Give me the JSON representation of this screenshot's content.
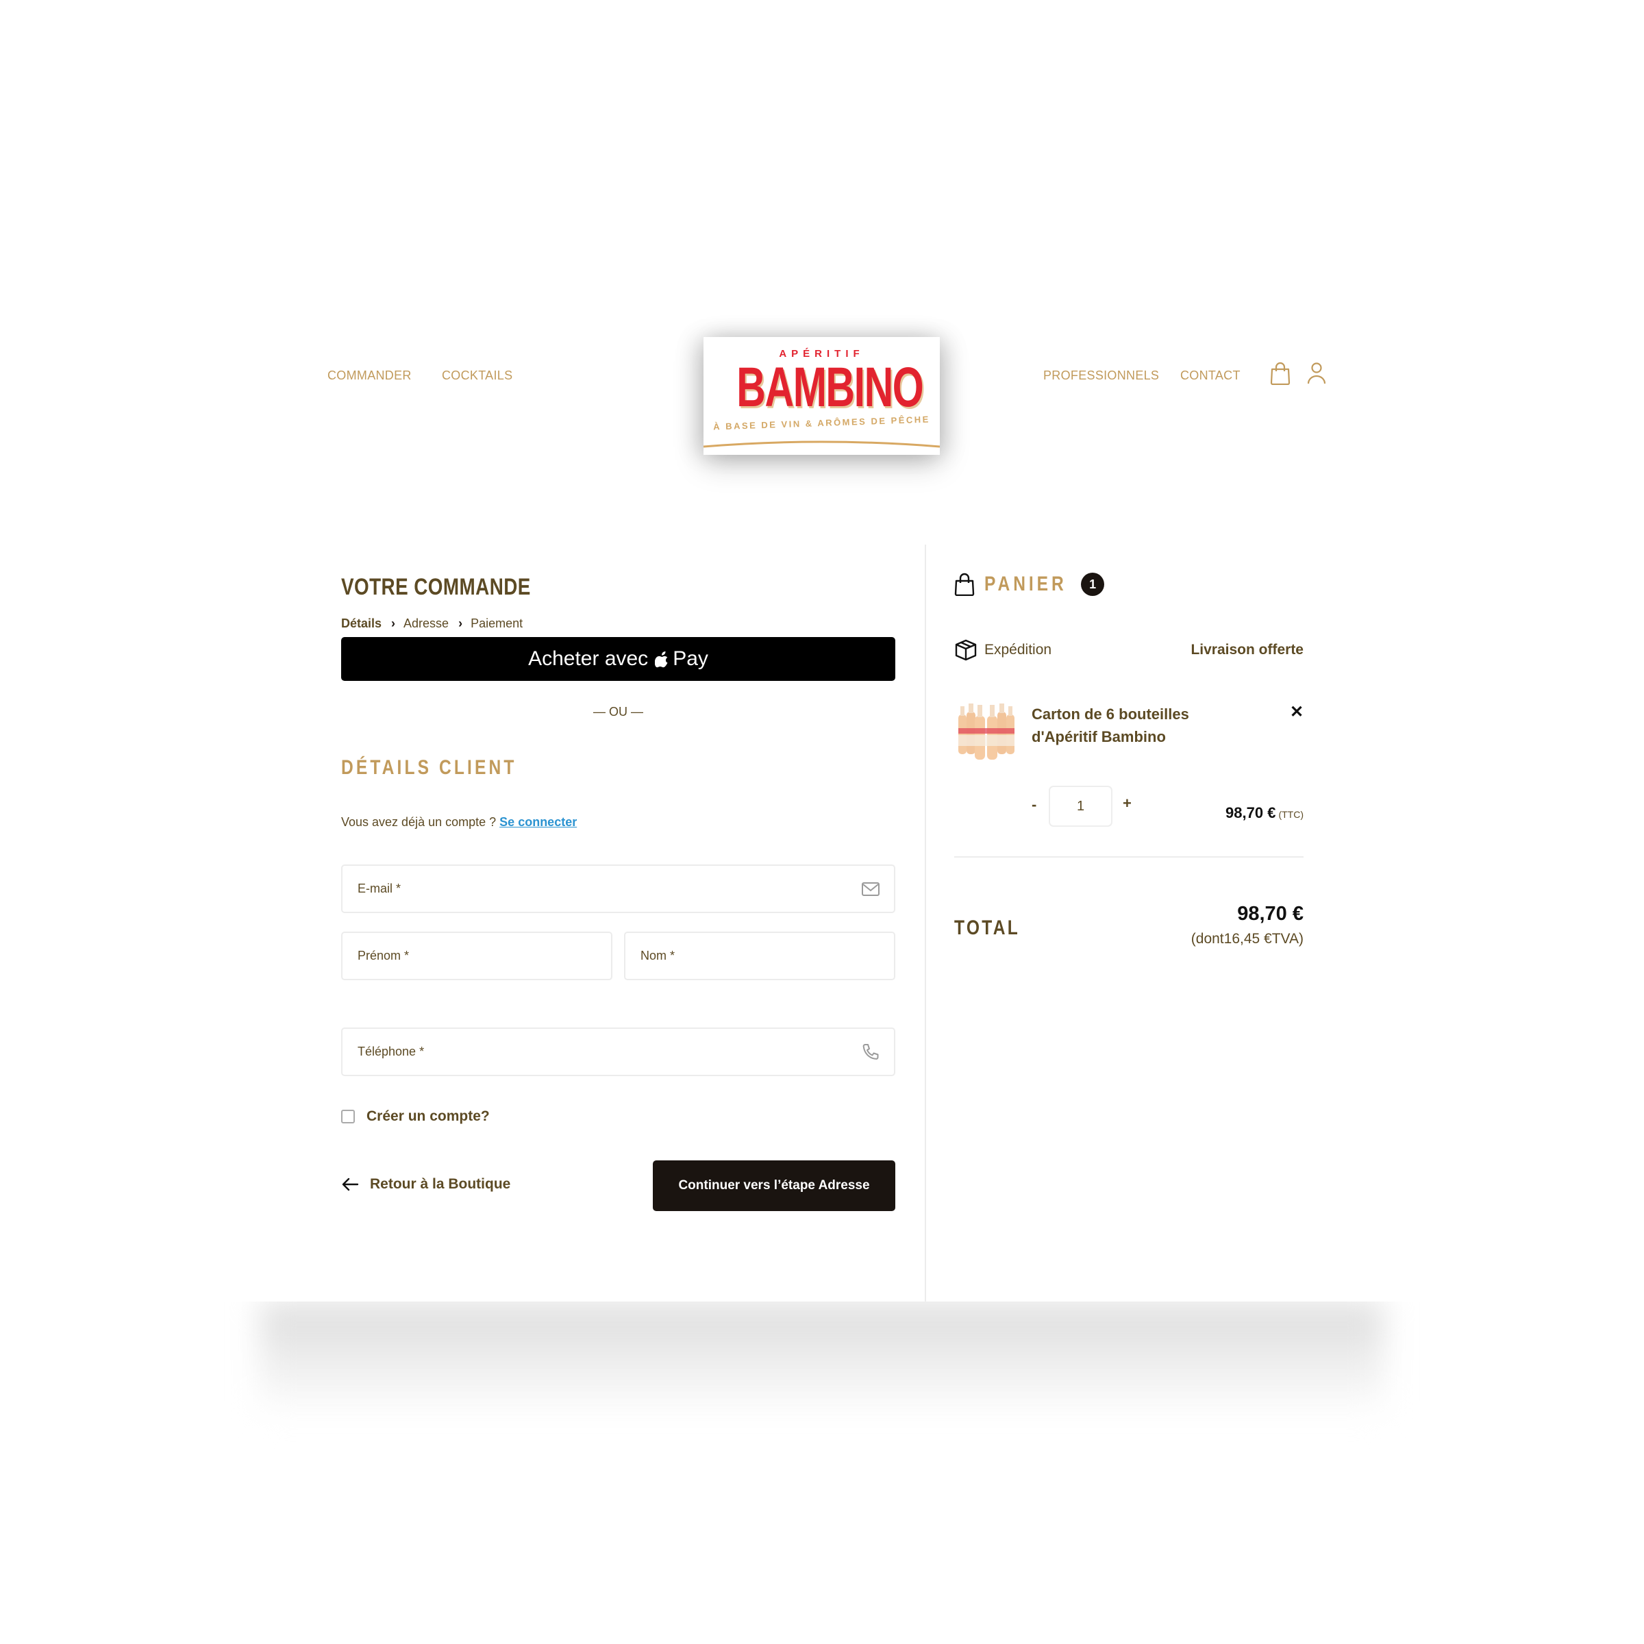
{
  "header": {
    "nav_left": [
      "COMMANDER",
      "COCKTAILS"
    ],
    "nav_right": [
      "PROFESSIONNELS",
      "CONTACT"
    ],
    "logo": {
      "top": "APÉRITIF",
      "main": "BAMBINO",
      "sub": "À BASE DE VIN & ARÔMES DE PÊCHE"
    },
    "icons": [
      "shopping-bag-icon",
      "user-icon"
    ],
    "colors": {
      "nav": "#c19a5b",
      "logo_red": "#e2232f",
      "logo_gold": "#d4a866"
    }
  },
  "checkout": {
    "title": "VOTRE COMMANDE",
    "steps": [
      {
        "label": "Détails",
        "active": true
      },
      {
        "label": "Adresse",
        "active": false
      },
      {
        "label": "Paiement",
        "active": false
      }
    ],
    "apple_pay": {
      "prefix": "Acheter avec",
      "brand": "Pay"
    },
    "separator": "— OU —",
    "client_section": {
      "title": "DÉTAILS CLIENT",
      "account_prompt": "Vous avez déjà un compte ?",
      "login_link": "Se connecter"
    },
    "fields": {
      "email": {
        "label": "E-mail *",
        "value": "",
        "icon": "mail-icon"
      },
      "first_name": {
        "label": "Prénom *",
        "value": ""
      },
      "last_name": {
        "label": "Nom *",
        "value": ""
      },
      "phone": {
        "label": "Téléphone *",
        "value": "",
        "icon": "phone-icon"
      }
    },
    "create_account": {
      "label": "Créer un compte?",
      "checked": false
    },
    "back_link": "Retour à la Boutique",
    "continue_button": "Continuer vers l’étape Adresse"
  },
  "cart": {
    "title": "PANIER",
    "count": "1",
    "shipping": {
      "label": "Expédition",
      "value": "Livraison offerte"
    },
    "items": [
      {
        "name": "Carton de 6 bouteilles d'Apéritif Bambino",
        "quantity": "1",
        "price": "98,70 €",
        "price_note": "(TTC)"
      }
    ],
    "total": {
      "label": "TOTAL",
      "value": "98,70 €",
      "tax_note": "(dont16,45 €TVA)"
    }
  }
}
